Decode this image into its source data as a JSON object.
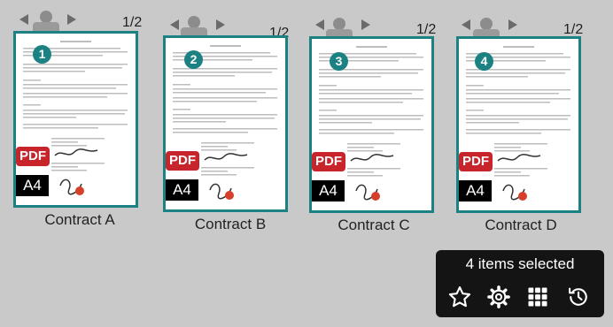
{
  "cards": [
    {
      "label": "Contract A",
      "page_count": "1/2",
      "index": "1",
      "format": "PDF",
      "size": "A4"
    },
    {
      "label": "Contract B",
      "page_count": "1/2",
      "index": "2",
      "format": "PDF",
      "size": "A4"
    },
    {
      "label": "Contract C",
      "page_count": "1/2",
      "index": "3",
      "format": "PDF",
      "size": "A4"
    },
    {
      "label": "Contract D",
      "page_count": "1/2",
      "index": "4",
      "format": "PDF",
      "size": "A4"
    }
  ],
  "toolbar": {
    "selection_text": "4 items selected",
    "buttons": [
      "star-icon",
      "gear-icon",
      "grid-icon",
      "history-icon"
    ]
  },
  "colors": {
    "accent": "#1b8183",
    "pdf": "#c8242b",
    "background": "#c9c9c9",
    "toolbar": "#141414"
  }
}
